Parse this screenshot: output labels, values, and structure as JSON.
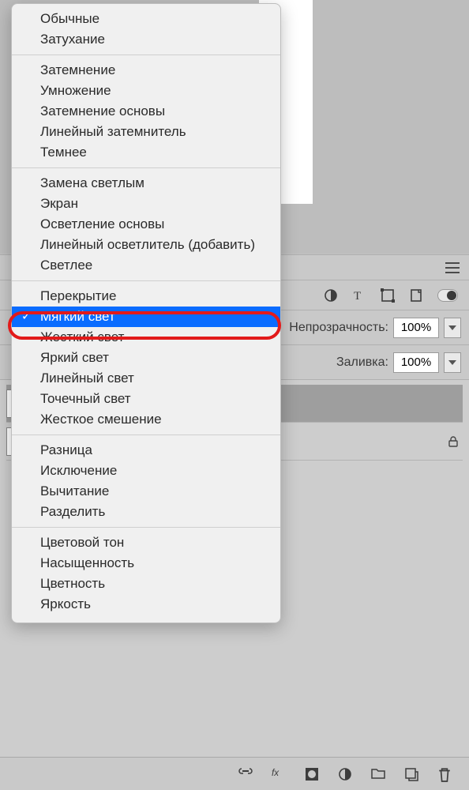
{
  "menu": {
    "groups": [
      [
        "Обычные",
        "Затухание"
      ],
      [
        "Затемнение",
        "Умножение",
        "Затемнение основы",
        "Линейный затемнитель",
        "Темнее"
      ],
      [
        "Замена светлым",
        "Экран",
        "Осветление основы",
        "Линейный осветлитель (добавить)",
        "Светлее"
      ],
      [
        "Перекрытие",
        "Мягкий свет",
        "Жесткий свет",
        "Яркий свет",
        "Линейный свет",
        "Точечный свет",
        "Жесткое смешение"
      ],
      [
        "Разница",
        "Исключение",
        "Вычитание",
        "Разделить"
      ],
      [
        "Цветовой тон",
        "Насыщенность",
        "Цветность",
        "Яркость"
      ]
    ],
    "selected": "Мягкий свет"
  },
  "panel": {
    "opacity_label": "Непрозрачность:",
    "opacity_value": "100%",
    "fill_label": "Заливка:",
    "fill_value": "100%"
  }
}
